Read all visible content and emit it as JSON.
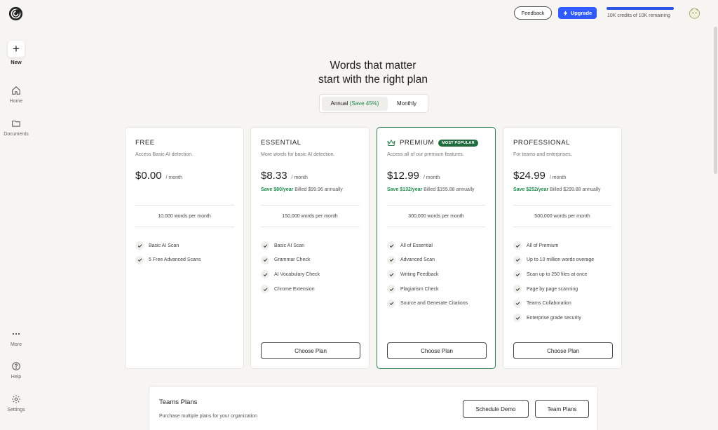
{
  "sidebar": {
    "new_label": "New",
    "items": [
      {
        "label": "Home",
        "icon": "home-icon"
      },
      {
        "label": "Documents",
        "icon": "folder-icon"
      },
      {
        "label": "More",
        "icon": "more-dots-icon"
      },
      {
        "label": "Help",
        "icon": "help-icon"
      },
      {
        "label": "Settings",
        "icon": "gear-icon"
      }
    ]
  },
  "topbar": {
    "feedback_label": "Feedback",
    "upgrade_label": "Upgrade",
    "credits_text": "10K credits of 10K remaining",
    "credits_fraction": 1.0
  },
  "heading": {
    "line1": "Words that matter",
    "line2": "start with the right plan"
  },
  "billing_toggle": {
    "annual_label": "Annual",
    "annual_save": "(Save 45%)",
    "monthly_label": "Monthly",
    "selected": "annual"
  },
  "plans": [
    {
      "name": "FREE",
      "description": "Access Basic AI detection.",
      "price": "$0.00",
      "period": "/ month",
      "save": "",
      "billed": "",
      "words": "10,000 words per month",
      "features": [
        "Basic AI Scan",
        "5 Free Advanced Scans"
      ],
      "cta": ""
    },
    {
      "name": "ESSENTIAL",
      "description": "More words for basic AI detection.",
      "price": "$8.33",
      "period": "/ month",
      "save": "Save $80/year",
      "billed": "Billed $99.96 annually",
      "words": "150,000 words per month",
      "features": [
        "Basic AI Scan",
        "Grammar Check",
        "AI Vocabulary Check",
        "Chrome Extension"
      ],
      "cta": "Choose Plan"
    },
    {
      "name": "PREMIUM",
      "badge": "MOST POPULAR",
      "description": "Access all of our premium features.",
      "price": "$12.99",
      "period": "/ month",
      "save": "Save $132/year",
      "billed": "Billed $155.88 annually",
      "words": "300,000 words per month",
      "features": [
        "All of Essential",
        "Advanced Scan",
        "Writing Feedback",
        "Plagiarism Check",
        "Source and Generate Citations"
      ],
      "cta": "Choose Plan"
    },
    {
      "name": "PROFESSIONAL",
      "description": "For teams and enterprises.",
      "price": "$24.99",
      "period": "/ month",
      "save": "Save $252/year",
      "billed": "Billed $299.88 annually",
      "words": "500,000 words per month",
      "features": [
        "All of Premium",
        "Up to 10 million words overage",
        "Scan up to 250 files at once",
        "Page by page scanning",
        "Teams Collaboration",
        "Enterprise grade security"
      ],
      "cta": "Choose Plan"
    }
  ],
  "teams": {
    "title": "Teams Plans",
    "description": "Purchase multiple plans for your organization",
    "schedule_demo_label": "Schedule Demo",
    "team_plans_label": "Team Plans"
  },
  "colors": {
    "accent_blue": "#2f5bff",
    "save_green": "#1f8a4c",
    "featured_border": "#2e7d4f",
    "background": "#f6f5f2"
  }
}
